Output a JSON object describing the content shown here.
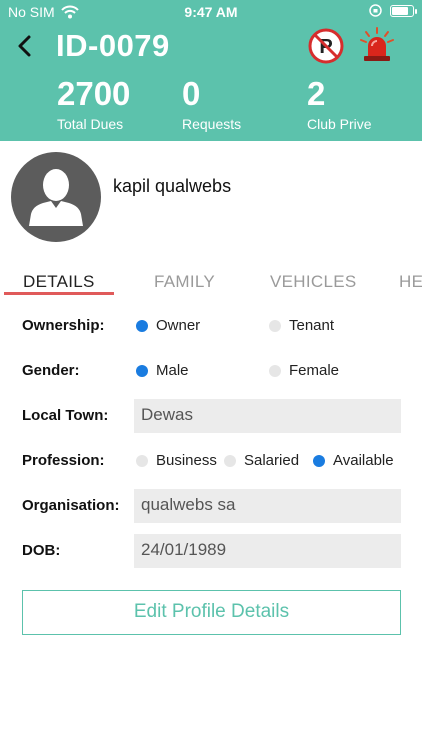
{
  "status_bar": {
    "carrier": "No SIM",
    "time": "9:47 AM",
    "battery_level": 0.9
  },
  "header": {
    "title": "ID-0079",
    "stats": [
      {
        "value": "2700",
        "label": "Total Dues"
      },
      {
        "value": "0",
        "label": "Requests"
      },
      {
        "value": "2",
        "label": "Club Prive"
      }
    ],
    "icons": [
      "back-arrow-icon",
      "no-parking-icon",
      "siren-icon"
    ],
    "color": "#5cc2ac"
  },
  "profile": {
    "name": "kapil qualwebs"
  },
  "tabs": [
    "DETAILS",
    "FAMILY",
    "VEHICLES",
    "HE"
  ],
  "details": {
    "ownership": {
      "label": "Ownership:",
      "options": [
        "Owner",
        "Tenant"
      ],
      "selected": "Owner"
    },
    "gender": {
      "label": "Gender:",
      "options": [
        "Male",
        "Female"
      ],
      "selected": "Male"
    },
    "local_town": {
      "label": "Local Town:",
      "value": "Dewas"
    },
    "profession": {
      "label": "Profession:",
      "options": [
        "Business",
        "Salaried",
        "Available"
      ],
      "selected": "Available"
    },
    "organisation": {
      "label": "Organisation:",
      "value": "qualwebs sa"
    },
    "dob": {
      "label": "DOB:",
      "value": "24/01/1989"
    }
  },
  "edit_button": "Edit Profile Details",
  "colors": {
    "accent": "#5cc2ac",
    "radio_on": "#1a7ce0",
    "tab_underline": "#e05a5a"
  }
}
